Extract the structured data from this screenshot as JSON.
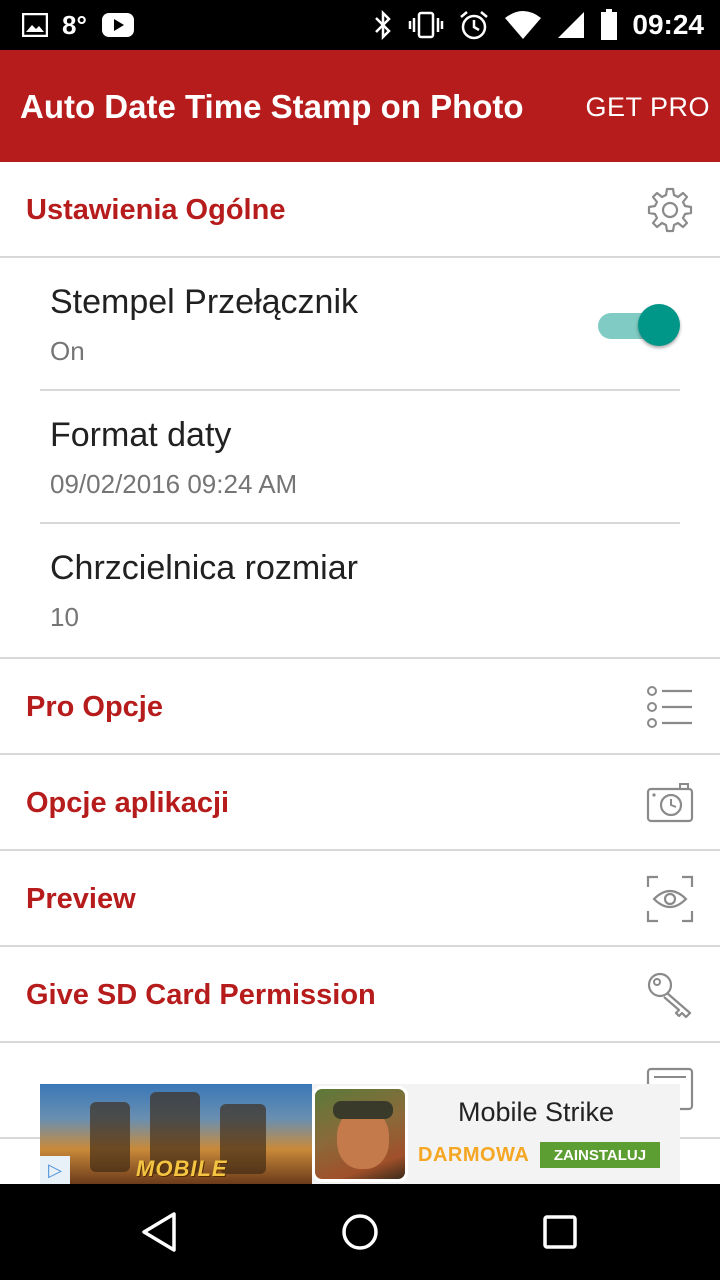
{
  "status_bar": {
    "temperature": "8°",
    "time": "09:24",
    "icons": [
      "image-icon",
      "youtube-icon",
      "bluetooth-icon",
      "vibrate-icon",
      "alarm-icon",
      "wifi-icon",
      "signal-icon",
      "battery-icon"
    ]
  },
  "app_bar": {
    "title": "Auto Date Time Stamp on Photo",
    "action": "GET PRO",
    "color": "#b71c1c"
  },
  "general_settings": {
    "title": "Ustawienia Ogólne",
    "icon": "gear-icon",
    "items": [
      {
        "title": "Stempel Przełącznik",
        "summary": "On",
        "toggle_on": true
      },
      {
        "title": "Format daty",
        "summary": "09/02/2016 09:24 AM"
      },
      {
        "title": "Chrzcielnica rozmiar",
        "summary": "10"
      }
    ]
  },
  "sections": [
    {
      "title": "Pro Opcje",
      "icon": "list-icon"
    },
    {
      "title": "Opcje aplikacji",
      "icon": "camera-clock-icon"
    },
    {
      "title": "Preview",
      "icon": "eye-icon"
    },
    {
      "title": "Give SD Card Permission",
      "icon": "key-icon"
    }
  ],
  "ad": {
    "image_text": "MOBILE",
    "app_name": "Mobile Strike",
    "price": "DARMOWA",
    "install": "ZAINSTALUJ"
  },
  "accent_colors": {
    "toggle_thumb": "#009688",
    "toggle_track": "#80cbc4",
    "install_button": "#5c9e31",
    "price_text": "#f5a623"
  }
}
